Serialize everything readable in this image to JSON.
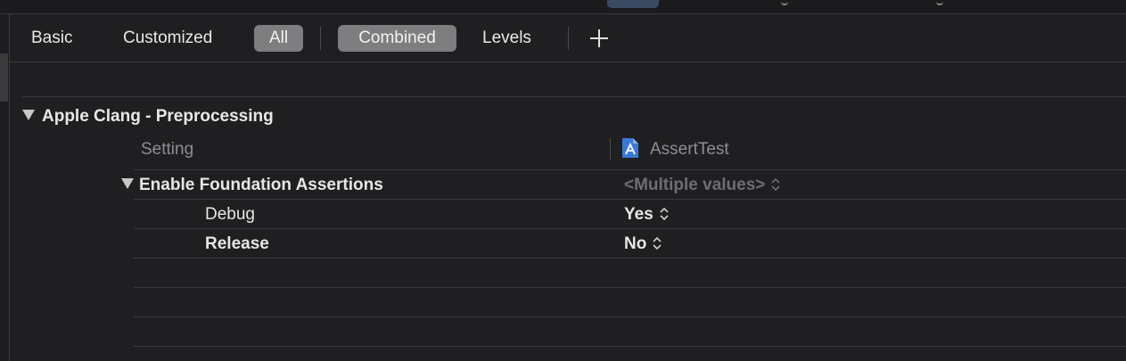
{
  "filter_bar": {
    "basic": "Basic",
    "customized": "Customized",
    "all": "All",
    "combined": "Combined",
    "levels": "Levels"
  },
  "section": {
    "title": "Apple Clang - Preprocessing"
  },
  "columns": {
    "setting": "Setting",
    "target": "AssertTest"
  },
  "setting": {
    "name": "Enable Foundation Assertions",
    "value": "<Multiple values>",
    "configs": [
      {
        "name": "Debug",
        "value": "Yes"
      },
      {
        "name": "Release",
        "value": "No"
      }
    ]
  },
  "icons": {
    "add": "plus-icon",
    "disclosure": "disclosure-triangle-icon",
    "target": "app-target-icon",
    "stepper": "up-down-stepper-icon"
  },
  "colors": {
    "background": "#1f1f21",
    "pill": "#7e7e80",
    "accent": "#3a78d6"
  }
}
